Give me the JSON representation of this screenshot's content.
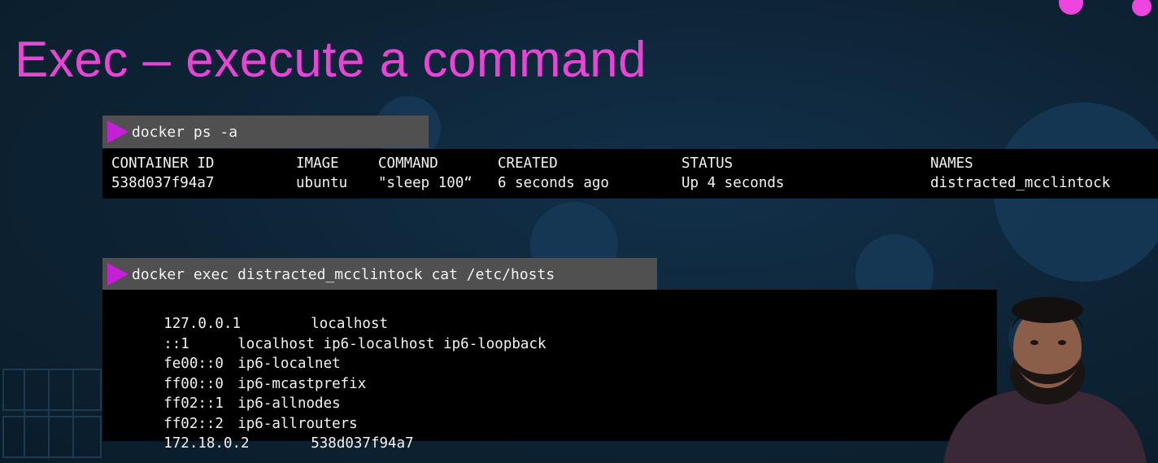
{
  "slide": {
    "title": "Exec – execute a command"
  },
  "ps_command": {
    "text": "docker ps -a"
  },
  "ps_output": {
    "headers": [
      "CONTAINER ID",
      "IMAGE",
      "COMMAND",
      "CREATED",
      "STATUS",
      "NAMES"
    ],
    "rows": [
      [
        "538d037f94a7",
        "ubuntu",
        "\"sleep 100“",
        "6 seconds ago",
        "Up 4 seconds",
        "distracted_mcclintock"
      ]
    ]
  },
  "exec_command": {
    "text": "docker exec distracted_mcclintock cat /etc/hosts"
  },
  "hosts_output": {
    "lines": [
      {
        "addr": "127.0.0.1",
        "names": "localhost"
      },
      {
        "addr": "::1",
        "names": "localhost ip6-localhost ip6-loopback"
      },
      {
        "addr": "fe00::0",
        "names": "ip6-localnet"
      },
      {
        "addr": "ff00::0",
        "names": "ip6-mcastprefix"
      },
      {
        "addr": "ff02::1",
        "names": "ip6-allnodes"
      },
      {
        "addr": "ff02::2",
        "names": "ip6-allrouters"
      },
      {
        "addr": "172.18.0.2",
        "names": "538d037f94a7"
      }
    ]
  },
  "colors": {
    "accent": "#e844d6",
    "prompt_arrow": "#c520d8",
    "command_bar": "#505050",
    "terminal_bg": "#000000",
    "slide_bg": "#0d2334"
  },
  "icons": {
    "prompt": "play-triangle-icon",
    "decor": "dot-icon"
  }
}
